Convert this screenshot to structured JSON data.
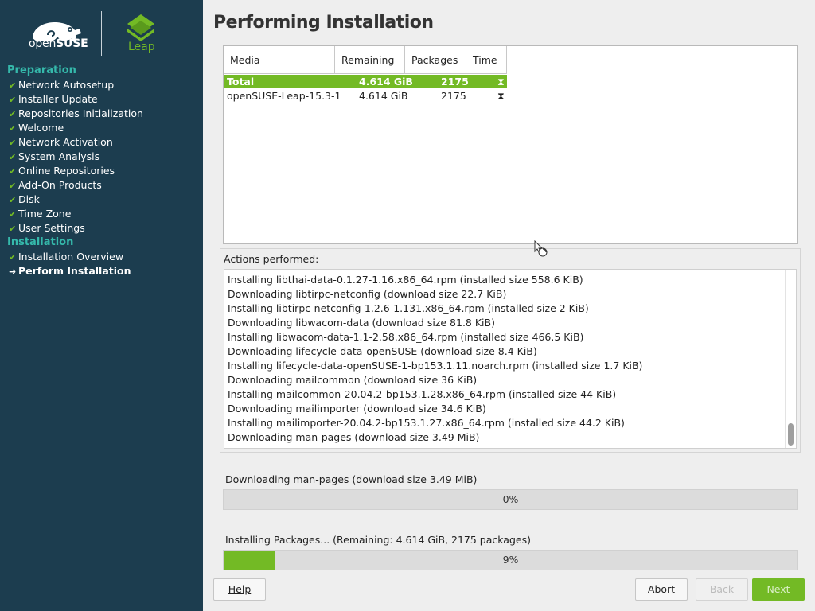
{
  "branding": {
    "suse_text_light": "open",
    "suse_text_bold": "SUSE",
    "leap_text": "Leap",
    "colors": {
      "sidebar": "#1c3d4f",
      "accent_green": "#73ba25",
      "group_teal": "#35b9ab"
    }
  },
  "sidebar": {
    "groups": [
      {
        "label": "Preparation",
        "steps": [
          {
            "label": "Network Autosetup",
            "status": "done"
          },
          {
            "label": "Installer Update",
            "status": "done"
          },
          {
            "label": "Repositories Initialization",
            "status": "done"
          },
          {
            "label": "Welcome",
            "status": "done"
          },
          {
            "label": "Network Activation",
            "status": "done"
          },
          {
            "label": "System Analysis",
            "status": "done"
          },
          {
            "label": "Online Repositories",
            "status": "done"
          },
          {
            "label": "Add-On Products",
            "status": "done"
          },
          {
            "label": "Disk",
            "status": "done"
          },
          {
            "label": "Time Zone",
            "status": "done"
          },
          {
            "label": "User Settings",
            "status": "done"
          }
        ]
      },
      {
        "label": "Installation",
        "steps": [
          {
            "label": "Installation Overview",
            "status": "done"
          },
          {
            "label": "Perform Installation",
            "status": "current"
          }
        ]
      }
    ],
    "check_glyph": "✔",
    "arrow_glyph": "➜"
  },
  "main": {
    "title": "Performing Installation",
    "media_table": {
      "headers": [
        "Media",
        "Remaining",
        "Packages",
        "Time"
      ],
      "rows": [
        {
          "media": "Total",
          "remaining": "4.614 GiB",
          "packages": "2175",
          "time_icon": "hourglass-icon",
          "selected": true
        },
        {
          "media": "openSUSE-Leap-15.3-1",
          "remaining": "4.614 GiB",
          "packages": "2175",
          "time_icon": "hourglass-icon",
          "selected": false
        }
      ]
    },
    "actions": {
      "label": "Actions performed:",
      "lines": [
        "Installing libthai-data-0.1.27-1.16.x86_64.rpm (installed size 558.6 KiB)",
        "Downloading libtirpc-netconfig (download size 22.7 KiB)",
        "Installing libtirpc-netconfig-1.2.6-1.131.x86_64.rpm (installed size 2 KiB)",
        "Downloading libwacom-data (download size 81.8 KiB)",
        "Installing libwacom-data-1.1-2.58.x86_64.rpm (installed size 466.5 KiB)",
        "Downloading lifecycle-data-openSUSE (download size 8.4 KiB)",
        "Installing lifecycle-data-openSUSE-1-bp153.1.11.noarch.rpm (installed size 1.7 KiB)",
        "Downloading mailcommon (download size 36 KiB)",
        "Installing mailcommon-20.04.2-bp153.1.28.x86_64.rpm (installed size 44 KiB)",
        "Downloading mailimporter (download size 34.6 KiB)",
        "Installing mailimporter-20.04.2-bp153.1.27.x86_64.rpm (installed size 44.2 KiB)",
        "Downloading man-pages (download size 3.49 MiB)"
      ]
    },
    "current_action": {
      "label": "Downloading man-pages (download size 3.49 MiB)",
      "percent": 0,
      "percent_text": "0%"
    },
    "total_progress": {
      "label": "Installing Packages... (Remaining: 4.614 GiB, 2175 packages)",
      "percent": 9,
      "percent_text": "9%"
    }
  },
  "buttons": {
    "help": "Help",
    "abort": "Abort",
    "back": "Back",
    "next": "Next"
  }
}
